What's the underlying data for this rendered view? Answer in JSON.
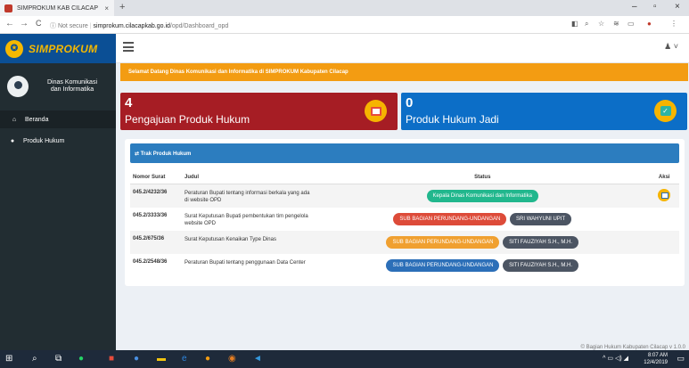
{
  "browser": {
    "tab_title": "SIMPROKUM KAB CILACAP",
    "tab_close": "×",
    "new_tab": "+",
    "win_minimize": "–",
    "win_maximize": "▫",
    "win_close": "×",
    "back": "←",
    "forward": "→",
    "reload": "C",
    "security_info": "ⓘ Not secure",
    "url_host": "simprokum.cilacapkab.go.id",
    "url_path": "/opd/Dashboard_opd",
    "menu": "⋮"
  },
  "app": {
    "logo_text": "SIMPROKUM",
    "user_name": "Dinas Komunikasi dan Informatika",
    "menu": [
      {
        "label": "Beranda",
        "icon": "home-icon",
        "glyph": "⌂"
      },
      {
        "label": "Produk Hukum",
        "icon": "user-icon",
        "glyph": "●"
      }
    ],
    "welcome": "Selamat Datang Dinas Komunikasi dan Informatika di SIMPROKUM Kabupaten Cilacap",
    "boxes": {
      "pengajuan": {
        "count": "4",
        "label": "Pengajuan Produk Hukum"
      },
      "jadi": {
        "count": "0",
        "label": "Produk Hukum Jadi"
      }
    },
    "panel_title": "⇄ Trak Produk Hukum",
    "table": {
      "headers": {
        "nomor": "Nomor Surat",
        "judul": "Judul",
        "status": "Status",
        "aksi": "Aksi"
      },
      "rows": [
        {
          "nomor": "045.2/4232/36",
          "judul": "Peraturan Bupati tentang informasi berkala yang ada di website OPD",
          "badges": [
            {
              "text": "Kepala Dinas Komunikasi dan Informatika",
              "color": "#21b78d"
            }
          ],
          "aksi": true
        },
        {
          "nomor": "045.2/3333/36",
          "judul": "Surat Keputusan Bupati pembentukan tim pengelola website OPD",
          "badges": [
            {
              "text": "SUB BAGIAN PERUNDANG-UNDANGAN",
              "color": "#dd4b39"
            },
            {
              "text": "SRI WAHYUNI UPIT",
              "color": "#4c5563"
            }
          ],
          "aksi": false
        },
        {
          "nomor": "045.2/675/36",
          "judul": "Surat Keputusan Kenaikan Type Dinas",
          "badges": [
            {
              "text": "SUB BAGIAN PERUNDANG-UNDANGAN",
              "color": "#f0a030"
            },
            {
              "text": "SITI FAUZIYAH S.H., M.H.",
              "color": "#4c5563"
            }
          ],
          "aksi": false
        },
        {
          "nomor": "045.2/2548/36",
          "judul": "Peraturan Bupati tentang penggunaan Data Center",
          "badges": [
            {
              "text": "SUB BAGIAN PERUNDANG-UNDANGAN",
              "color": "#2c6fb8"
            },
            {
              "text": "SITI FAUZIYAH S.H., M.H.",
              "color": "#4c5563"
            }
          ],
          "aksi": false
        }
      ]
    },
    "footer": "© Bagian Hukum Kabupaten Cilacap v 1.0.0"
  },
  "taskbar": {
    "time": "8:07 AM",
    "date": "12/4/2019"
  },
  "colors": {
    "sidebar": "#222d32",
    "logo_bg": "#0b4f95",
    "welcome": "#f39c12",
    "box_red": "#a61d24",
    "box_blue": "#0c6ec7",
    "panel_head": "#2c7dbf"
  }
}
